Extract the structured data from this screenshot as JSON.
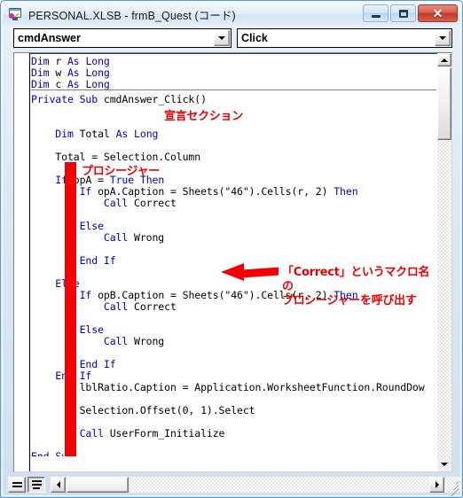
{
  "window": {
    "title": "PERSONAL.XLSB - frmB_Quest (コード)",
    "icon": "vba-userform-icon",
    "buttons": {
      "minimize": "minimize-icon",
      "maximize": "maximize-icon",
      "close": "✕"
    }
  },
  "toolbar": {
    "object_combo": {
      "value": "cmdAnswer",
      "arrow": "chevron-down-icon"
    },
    "procedure_combo": {
      "value": "Click",
      "arrow": "chevron-down-icon"
    }
  },
  "code": {
    "declaration_lines": [
      "Dim r As Long",
      "Dim w As Long",
      "Dim c As Long"
    ],
    "procedure_lines": [
      "Private Sub cmdAnswer_Click()",
      "",
      "",
      "    Dim Total As Long",
      "",
      "    Total = Selection.Column",
      "",
      "    If opA = True Then",
      "        If opA.Caption = Sheets(\"46\").Cells(r, 2) Then",
      "            Call Correct",
      "",
      "        Else",
      "            Call Wrong",
      "",
      "        End If",
      "",
      "    Else",
      "        If opB.Caption = Sheets(\"46\").Cells(r, 2) Then",
      "            Call Correct",
      "",
      "        Else",
      "            Call Wrong",
      "",
      "        End If",
      "    End If",
      "        lblRatio.Caption = Application.WorksheetFunction.RoundDow",
      "",
      "        Selection.Offset(0, 1).Select",
      "",
      "        Call UserForm_Initialize",
      "",
      "End Sub"
    ]
  },
  "annotations": {
    "declaration_note": "宣言セクション",
    "procedure_note": "プロシージャー",
    "correct_note": "「Correct」というマクロ名の\nプロシージャーを呼び出す",
    "color": "#ee0000"
  },
  "status_bar": {
    "procedure_view_button": "procedure-view-icon",
    "full_module_view_button": "full-module-view-icon"
  },
  "scrollbars": {
    "vertical": {
      "up": "▲",
      "down": "▼"
    },
    "horizontal": {
      "left": "◀",
      "right": "▶"
    }
  }
}
